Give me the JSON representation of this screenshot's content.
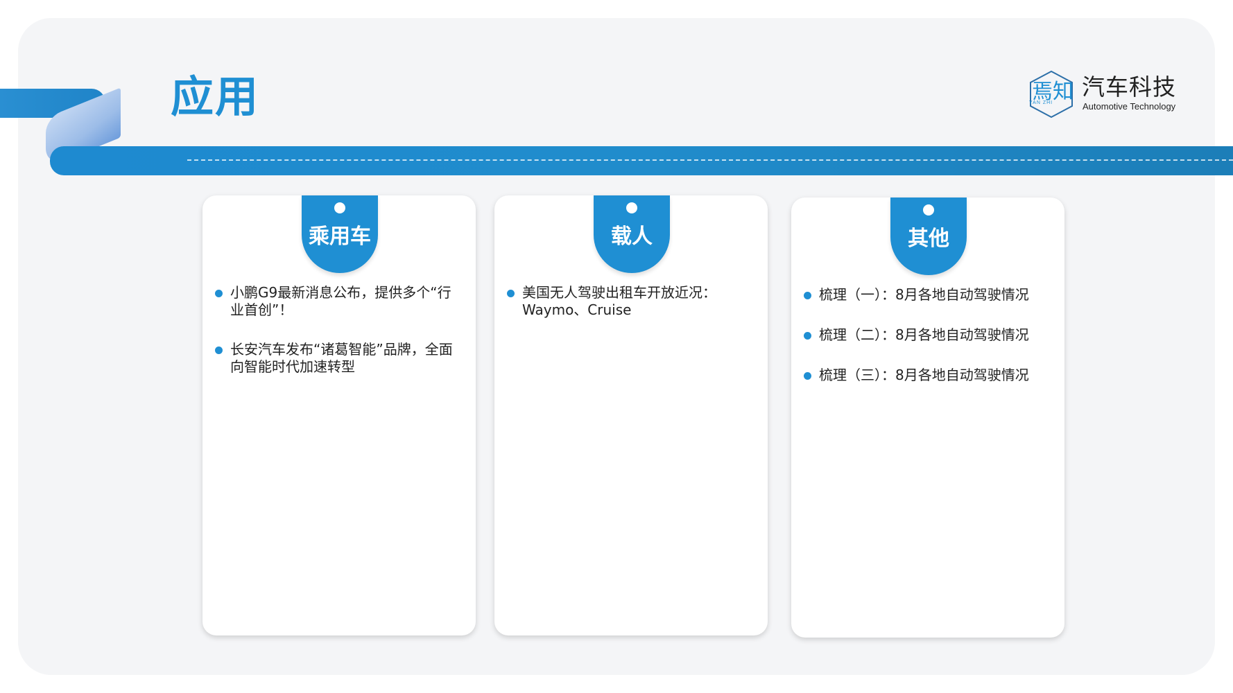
{
  "header": {
    "title": "应用"
  },
  "logo": {
    "mark_text": "焉知",
    "mark_sub": "YAN ZHI",
    "name_cn": "汽车科技",
    "name_en": "Automotive Technology",
    "icon": "hexagon-logo-icon"
  },
  "watermark": "焉知",
  "colors": {
    "accent": "#1f8fd3",
    "background": "#f4f5f7",
    "card": "#ffffff"
  },
  "cards": [
    {
      "label": "乘用车",
      "items": [
        "小鹏G9最新消息公布，提供多个“行业首创”！",
        "长安汽车发布“诸葛智能”品牌，全面向智能时代加速转型"
      ]
    },
    {
      "label": "载人",
      "items": [
        "美国无人驾驶出租车开放近况：Waymo、Cruise"
      ]
    },
    {
      "label": "其他",
      "items": [
        "梳理（一）：8月各地自动驾驶情况",
        "梳理（二）：8月各地自动驾驶情况",
        "梳理（三）：8月各地自动驾驶情况"
      ]
    }
  ]
}
